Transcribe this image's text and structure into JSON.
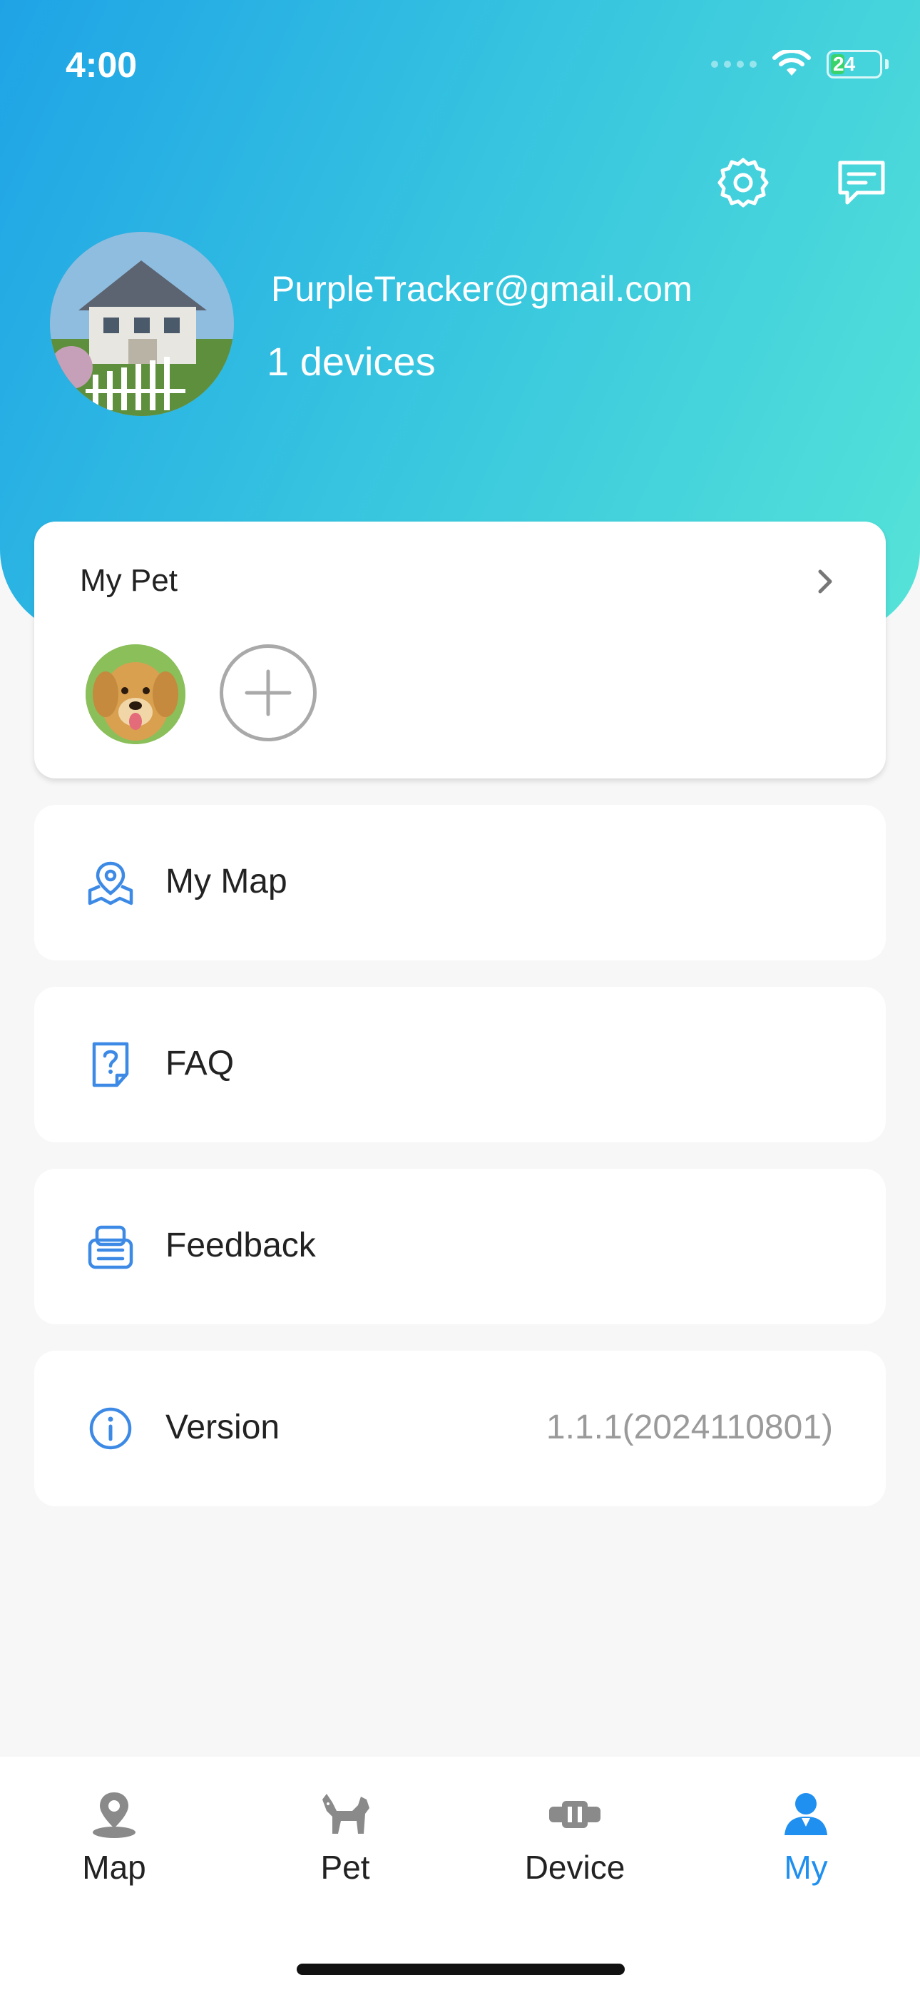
{
  "status_bar": {
    "time": "4:00",
    "battery": "24"
  },
  "header": {
    "email": "PurpleTracker@gmail.com",
    "devices": "1 devices",
    "icons": [
      "gear-icon",
      "message-icon"
    ]
  },
  "pet_card": {
    "title": "My Pet"
  },
  "menu": [
    {
      "label": "My Map",
      "icon": "map-pin-icon"
    },
    {
      "label": "FAQ",
      "icon": "question-doc-icon"
    },
    {
      "label": "Feedback",
      "icon": "feedback-icon"
    },
    {
      "label": "Version",
      "icon": "info-icon",
      "value": "1.1.1(2024110801)"
    }
  ],
  "tabs": [
    {
      "label": "Map",
      "icon": "location-icon",
      "active": false
    },
    {
      "label": "Pet",
      "icon": "dog-icon",
      "active": false
    },
    {
      "label": "Device",
      "icon": "tracker-device-icon",
      "active": false
    },
    {
      "label": "My",
      "icon": "user-icon",
      "active": true
    }
  ],
  "colors": {
    "accent": "#1f8ff0",
    "icon_blue": "#3d8ae6",
    "gradient_start": "#1fa3e6",
    "gradient_end": "#55e3d8"
  }
}
